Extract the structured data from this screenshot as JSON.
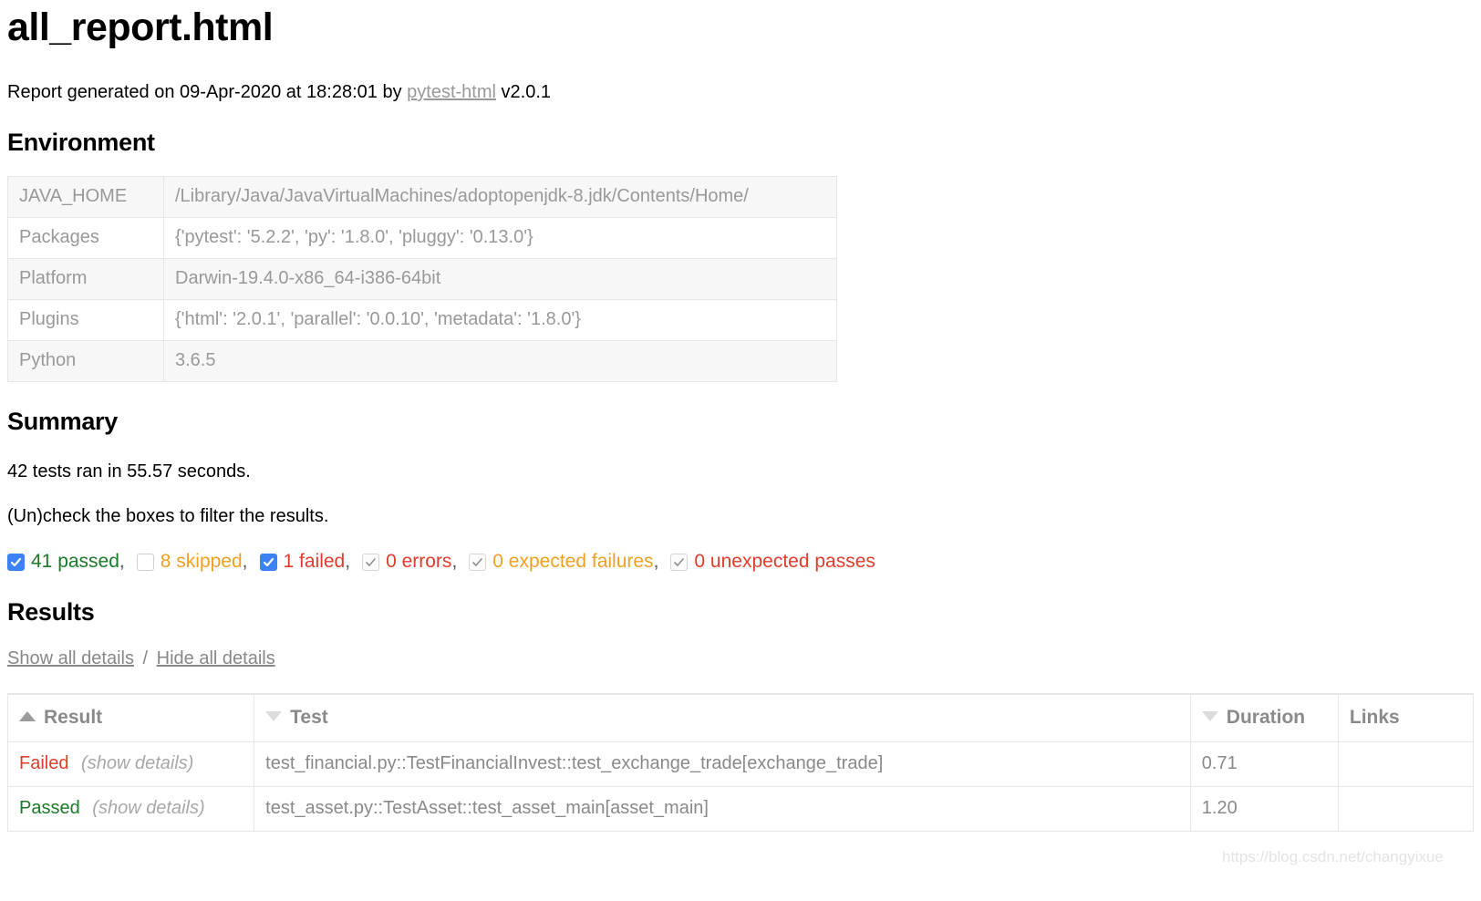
{
  "report": {
    "title": "all_report.html",
    "generated_prefix": "Report generated on",
    "generated_date": "09-Apr-2020",
    "generated_at_word": "at",
    "generated_time": "18:28:01",
    "generated_by_word": "by",
    "generator_link": "pytest-html",
    "generator_version": "v2.0.1"
  },
  "environment": {
    "heading": "Environment",
    "rows": [
      {
        "key": "JAVA_HOME",
        "value": "/Library/Java/JavaVirtualMachines/adoptopenjdk-8.jdk/Contents/Home/"
      },
      {
        "key": "Packages",
        "value": "{'pytest': '5.2.2', 'py': '1.8.0', 'pluggy': '0.13.0'}"
      },
      {
        "key": "Platform",
        "value": "Darwin-19.4.0-x86_64-i386-64bit"
      },
      {
        "key": "Plugins",
        "value": "{'html': '2.0.1', 'parallel': '0.0.10', 'metadata': '1.8.0'}"
      },
      {
        "key": "Python",
        "value": "3.6.5"
      }
    ]
  },
  "summary": {
    "heading": "Summary",
    "tests_ran": "42 tests ran in 55.57 seconds.",
    "filter_hint": "(Un)check the boxes to filter the results.",
    "filters": [
      {
        "label": "41 passed",
        "state": "checked",
        "color": "#1a7a28",
        "separator": ","
      },
      {
        "label": "8 skipped",
        "state": "unchecked",
        "color": "#f0a024",
        "separator": ","
      },
      {
        "label": "1 failed",
        "state": "checked",
        "color": "#e13c2b",
        "separator": ","
      },
      {
        "label": "0 errors",
        "state": "disabled",
        "color": "#e13c2b",
        "separator": ","
      },
      {
        "label": "0 expected failures",
        "state": "disabled",
        "color": "#f0a024",
        "separator": ","
      },
      {
        "label": "0 unexpected passes",
        "state": "disabled",
        "color": "#e13c2b",
        "separator": ""
      }
    ]
  },
  "results": {
    "heading": "Results",
    "show_all": "Show all details",
    "separator": "/",
    "hide_all": "Hide all details",
    "columns": [
      {
        "label": "Result",
        "sort": "asc"
      },
      {
        "label": "Test",
        "sort": "desc"
      },
      {
        "label": "Duration",
        "sort": "desc"
      },
      {
        "label": "Links",
        "sort": "none"
      }
    ],
    "show_details_label": "(show details)",
    "rows": [
      {
        "outcome": "Failed",
        "outcome_class": "failed",
        "test": "test_financial.py::TestFinancialInvest::test_exchange_trade[exchange_trade]",
        "duration": "0.71",
        "links": ""
      },
      {
        "outcome": "Passed",
        "outcome_class": "passed",
        "test": "test_asset.py::TestAsset::test_asset_main[asset_main]",
        "duration": "1.20",
        "links": ""
      }
    ]
  },
  "watermark": "https://blog.csdn.net/changyixue"
}
